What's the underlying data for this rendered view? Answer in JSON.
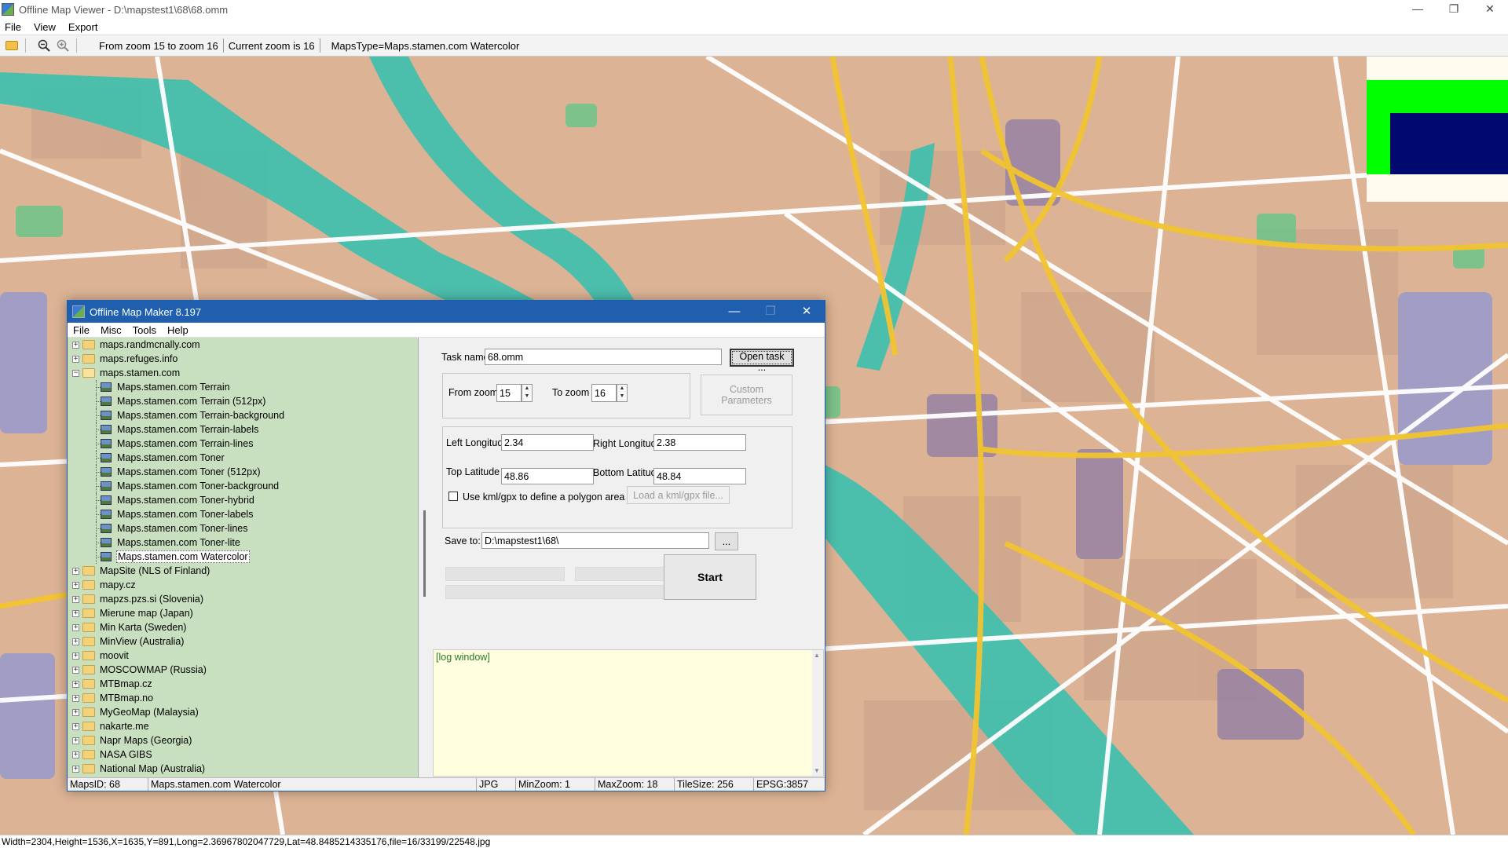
{
  "window": {
    "title": "Offline Map Viewer - D:\\mapstest1\\68\\68.omm",
    "controls": [
      "—",
      "❐",
      "✕"
    ]
  },
  "menu": [
    "File",
    "View",
    "Export"
  ],
  "toolbar": {
    "zoom_range": "From zoom 15 to zoom 16",
    "current_zoom": "Current zoom is 16",
    "maps_type": "MapsType=Maps.stamen.com Watercolor"
  },
  "bottom_status": "Width=2304,Height=1536,X=1635,Y=891,Long=2.36967802047729,Lat=48.8485214335176,file=16/33199/22548.jpg",
  "colors": {
    "map_base": "#dcb394",
    "road_yellow": "#f2c431",
    "water": "#3cbfae",
    "dialog_title": "#1f5fae",
    "tree_bg": "#c8dfc0",
    "log_bg": "#ffffe0",
    "marker_green": "#00ff00",
    "marker_navy": "#000a6e"
  },
  "dialog": {
    "title": "Offline Map Maker 8.197",
    "menu": [
      "File",
      "Misc",
      "Tools",
      "Help"
    ],
    "tree": [
      {
        "label": "maps.randmcnally.com",
        "type": "folder",
        "expanded": false
      },
      {
        "label": "maps.refuges.info",
        "type": "folder",
        "expanded": false
      },
      {
        "label": "maps.stamen.com",
        "type": "folder",
        "expanded": true
      },
      {
        "label": "Maps.stamen.com Terrain",
        "type": "map"
      },
      {
        "label": "Maps.stamen.com Terrain (512px)",
        "type": "map"
      },
      {
        "label": "Maps.stamen.com Terrain-background",
        "type": "map"
      },
      {
        "label": "Maps.stamen.com Terrain-labels",
        "type": "map"
      },
      {
        "label": "Maps.stamen.com Terrain-lines",
        "type": "map"
      },
      {
        "label": "Maps.stamen.com Toner",
        "type": "map"
      },
      {
        "label": "Maps.stamen.com Toner (512px)",
        "type": "map"
      },
      {
        "label": "Maps.stamen.com Toner-background",
        "type": "map"
      },
      {
        "label": "Maps.stamen.com Toner-hybrid",
        "type": "map"
      },
      {
        "label": "Maps.stamen.com Toner-labels",
        "type": "map"
      },
      {
        "label": "Maps.stamen.com Toner-lines",
        "type": "map"
      },
      {
        "label": "Maps.stamen.com Toner-lite",
        "type": "map"
      },
      {
        "label": "Maps.stamen.com Watercolor",
        "type": "map",
        "selected": true
      },
      {
        "label": "MapSite (NLS of Finland)",
        "type": "folder",
        "expanded": false
      },
      {
        "label": "mapy.cz",
        "type": "folder",
        "expanded": false
      },
      {
        "label": "mapzs.pzs.si (Slovenia)",
        "type": "folder",
        "expanded": false
      },
      {
        "label": "Mierune map (Japan)",
        "type": "folder",
        "expanded": false
      },
      {
        "label": "Min Karta (Sweden)",
        "type": "folder",
        "expanded": false
      },
      {
        "label": "MinView (Australia)",
        "type": "folder",
        "expanded": false
      },
      {
        "label": "moovit",
        "type": "folder",
        "expanded": false
      },
      {
        "label": "MOSCOWMAP (Russia)",
        "type": "folder",
        "expanded": false
      },
      {
        "label": "MTBmap.cz",
        "type": "folder",
        "expanded": false
      },
      {
        "label": "MTBmap.no",
        "type": "folder",
        "expanded": false
      },
      {
        "label": "MyGeoMap (Malaysia)",
        "type": "folder",
        "expanded": false
      },
      {
        "label": "nakarte.me",
        "type": "folder",
        "expanded": false
      },
      {
        "label": "Napr Maps (Georgia)",
        "type": "folder",
        "expanded": false
      },
      {
        "label": "NASA GIBS",
        "type": "folder",
        "expanded": false
      },
      {
        "label": "National Map (Australia)",
        "type": "folder",
        "expanded": false
      }
    ],
    "form": {
      "task_name_label": "Task name",
      "task_name_value": "68.omm",
      "open_task_button": "Open task ...",
      "from_zoom_label": "From zoom",
      "from_zoom_value": "15",
      "to_zoom_label": "To zoom",
      "to_zoom_value": "16",
      "custom_params_button": "Custom Parameters",
      "left_lon_label": "Left Longitude",
      "left_lon_value": "2.34",
      "right_lon_label": "Right Longitude",
      "right_lon_value": "2.38",
      "top_lat_label": "Top Latitude",
      "top_lat_value": "48.86",
      "bottom_lat_label": "Bottom Latitude",
      "bottom_lat_value": "48.84",
      "kml_checkbox_label": "Use kml/gpx to define a polygon area",
      "load_kml_button": "Load a kml/gpx file...",
      "save_to_label": "Save to:",
      "save_to_value": "D:\\mapstest1\\68\\",
      "browse_button": "...",
      "start_button": "Start"
    },
    "log_text": "[log window]",
    "status": {
      "maps_id": "MapsID: 68",
      "maps_name": "Maps.stamen.com Watercolor",
      "format": "JPG",
      "min_zoom": "MinZoom: 1",
      "max_zoom": "MaxZoom: 18",
      "tile_size": "TileSize: 256",
      "epsg": "EPSG:3857"
    }
  }
}
